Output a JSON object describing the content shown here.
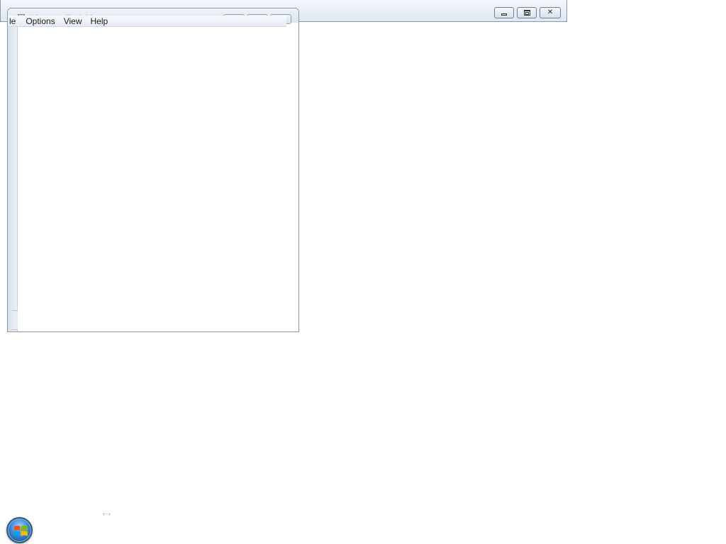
{
  "background_window": {
    "controls": {
      "minimize_icon": "minimize-icon",
      "maximize_icon": "restore-icon",
      "close_label": "✕"
    }
  },
  "task_manager": {
    "title": "Windows Task Manager",
    "menu": [
      {
        "label": "le"
      },
      {
        "label": "Options"
      },
      {
        "label": "View"
      },
      {
        "label": "Help"
      }
    ]
  },
  "desktop": {
    "bottom_artifact": "‹··›",
    "start_button_icon": "windows-logo-icon"
  },
  "colors": {
    "accent": "#3b8ad6",
    "window_chrome": "#dbe4ef"
  }
}
